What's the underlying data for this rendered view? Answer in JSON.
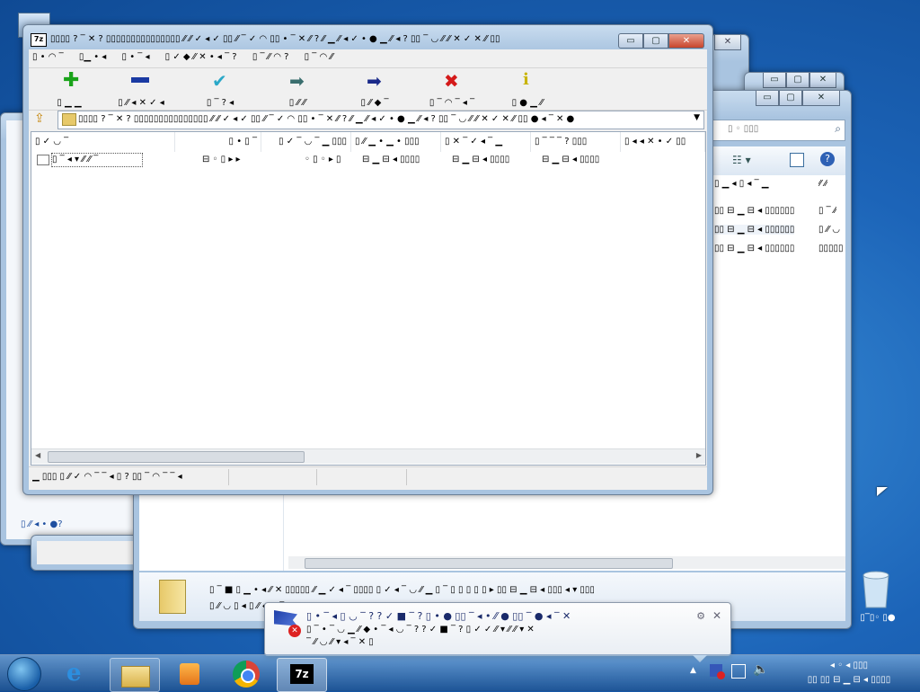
{
  "desktop": {
    "recycle_bin_label": "▯‾▯◦ ▯●"
  },
  "window_7z": {
    "title": "▯▯▯▯ ? ‾ ✕ ? ▯▯▯▯▯▯▯▯▯▯▯▯▯▯▯ ⁄⁄ ⁄⁄ ✓ ◂ ✓ ▯▯ ⁄⁄ ‾ ✓ ◠ ▯▯ • ‾ ✕ ⁄⁄ ? ⁄⁄ ▁ ⁄⁄ ◂ ✓ • ● ▁ ⁄⁄ ◂ ? ▯▯ ‾ ◡ ⁄⁄ ⁄⁄ ✕ ✓ ✕ ⁄⁄ ▯▯",
    "menu": [
      "▯ • ◠ ‾",
      "▯▁ • ◂",
      "▯ • ‾ ◂",
      "▯ ✓ ◆ ⁄⁄ ✕ • ◂ ‾ ?",
      "▯ ‾ ⁄⁄ ◠ ?",
      "▯ ‾ ◠ ⁄⁄"
    ],
    "toolbar": [
      {
        "icon": "add-icon",
        "label": "▯ ▁ ▁",
        "color": "#1aa31a"
      },
      {
        "icon": "extract-icon",
        "label": "▯ ⁄⁄ ◂ ✕ ✓ ◂",
        "color": "#1a3aa3"
      },
      {
        "icon": "test-icon",
        "label": "▯ ‾ ? ◂",
        "color": "#2aa8c8"
      },
      {
        "icon": "copy-icon",
        "label": "▯ ⁄⁄ ⁄⁄",
        "color": "#3a6e6e"
      },
      {
        "icon": "move-icon",
        "label": "▯ ⁄⁄ ◆ ‾",
        "color": "#1a2a8a"
      },
      {
        "icon": "delete-icon",
        "label": "▯ ‾ ◠ ‾ ◂ ‾",
        "color": "#d41a1a"
      },
      {
        "icon": "info-icon",
        "label": "▯ ● ▁ ⁄⁄",
        "color": "#c8b400"
      }
    ],
    "address_path": "▯▯▯▯ ? ‾ ✕ ? ▯▯▯▯▯▯▯▯▯▯▯▯▯▯▯ ⁄⁄ ⁄⁄ ✓ ◂ ✓ ▯▯ ⁄⁄ ‾ ✓ ◠ ▯▯ • ‾ ✕ ⁄⁄ ? ⁄⁄ ▁ ⁄⁄ ◂ ✓ • ● ▁ ⁄⁄ ◂ ? ▯▯ ‾ ◡ ⁄⁄ ⁄⁄ ✕ ✓ ✕ ⁄⁄ ▯▯ ● ◂ ‾ ✕ ●",
    "columns": [
      "▯ ✓ ◡ ‾",
      "▯ • ▯ ‾",
      "▯ ✓ ‾ ◡ ‾ ▁ ▯▯▯",
      "▯ ⁄⁄ ▁ • ▁ • ▯▯▯",
      "▯ ✕ ‾ ✓ ◂ ‾ ▁",
      "▯ ‾ ‾ ‾ ? ▯▯▯",
      "▯ ◂ ◂ ✕ • ✓ ▯▯"
    ],
    "rows": [
      {
        "name": "▯ ‾ ◂ ▾ ⁄⁄ ⁄⁄ ‾",
        "size": "⊟ ◦ ▯ ▸ ▸",
        "packed": "◦ ▯ ◦ ▸ ▯",
        "modified": "⊟ ▁ ⊟ ◂ ▯▯▯▯",
        "created": "⊟ ▁ ⊟ ◂ ▯▯▯▯",
        "accessed": "⊟ ▁ ⊟ ◂ ▯▯▯▯"
      }
    ],
    "status": "▁ ▯▯▯ ▯ ⁄⁄ ✓ ◠ ‾ ‾ ◂ ▯ ? ▯▯ ‾ ◠ ‾ ‾ ◂"
  },
  "window_explorer": {
    "search_placeholder": "▯ ◦ ▯▯▯",
    "header_col": "▯ ▁ ◂ ▯ ◂ ‾ ▁",
    "header_col2": "⁄⁄ ⁄⁄",
    "rows": [
      {
        "date": "▯▯ ⊟ ▁ ⊟ ◂ ▯▯▯▯▯▯",
        "type": "▯ ‾ ⁄⁄"
      },
      {
        "date": "▯▯ ⊟ ▁ ⊟ ◂ ▯▯▯▯▯▯",
        "type": "▯ ⁄⁄ ◡"
      },
      {
        "date": "▯▯ ⊟ ▁ ⊟ ◂ ▯▯▯▯▯▯",
        "type": "▯▯▯▯▯"
      }
    ],
    "details_line1": "▯ ‾ ■ ▯ ▁ • ◂ ⁄⁄ ✕ ▯▯▯▯▯ ⁄⁄ ▁ ✓ ◂ ‾ ▯▯▯▯ ▯ ✓ ◂ ‾ ◡ ⁄⁄ ▁ ▯ ‾ ▯ ▯ ▯ ▯ ▯ ▸ ▯▯ ⊟ ▁ ⊟ ◂ ▯▯▯ ◂ ▾ ▯▯▯",
    "details_line2": "▯ ⁄⁄ ◡ ▯ ◂ ▯ ⁄⁄ ◆ ◂ ‾ ✓ ✕ ▯ ▯ ⁄⁄ ⁄⁄ ◡ ▯ ◂ ▯ ▯"
  },
  "window_left_back": {
    "link": "▯ ⁄⁄ ◂ • ●?"
  },
  "notification": {
    "line1": "▯ • ‾ ◂ ▯ ◡ ‾ ? ? ✓ ■ ‾ ? ▯ • ● ▯▯ ‾ ◂ • ⁄⁄ ● ▯▯ ‾ ● ◂ ‾ ✕",
    "line2": "▯ ‾ • ‾ ◡ ▁ ⁄⁄ ◆ • ‾ ◂ ◡ ‾ ? ? ✓ ■ ‾ ? ▯ ✓ ✓ ⁄⁄ ▾ ⁄⁄ ⁄⁄ ▾ ✕",
    "line3": "‾ ⁄⁄ ◡ ⁄⁄ ▾ ◂ ‾ ✕ ▯"
  },
  "taskbar": {
    "clock_time": "◂ ◦ ◂ ▯▯▯",
    "clock_date": "▯▯ ▯▯ ⊟ ▁ ⊟ ◂ ▯▯▯▯"
  },
  "colors": {
    "titlebar": "#b9d1ea",
    "accent_blue": "#1c64b8",
    "close_red": "#c7452c"
  }
}
